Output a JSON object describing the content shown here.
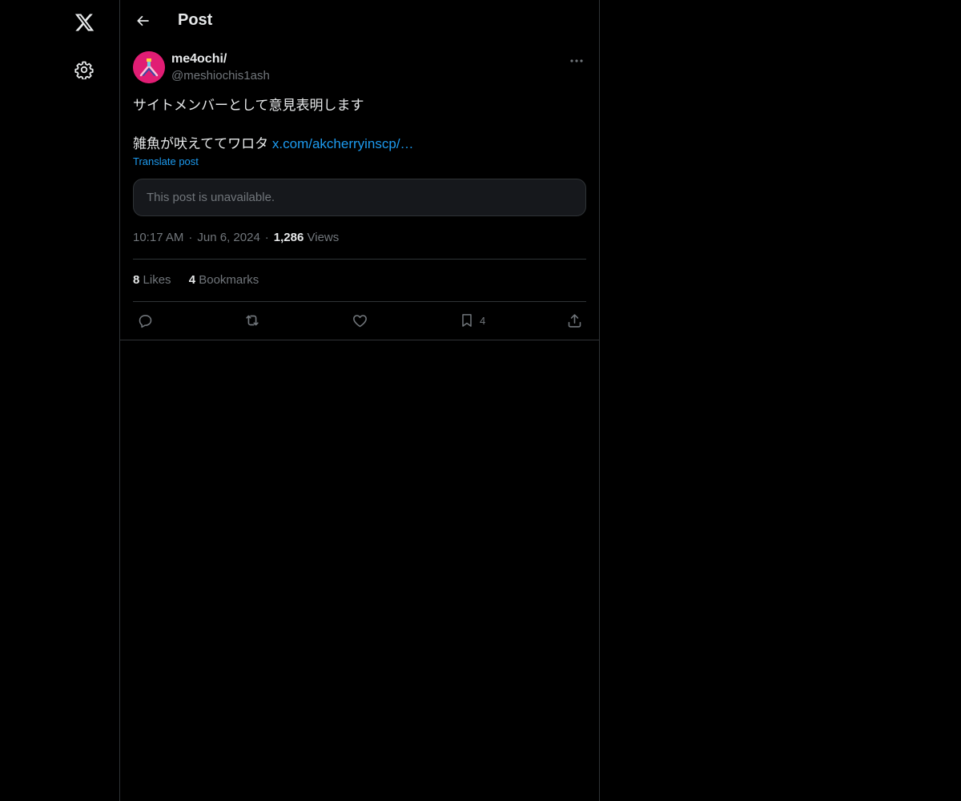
{
  "nav": {
    "logo_icon": "x-logo-icon",
    "settings_icon": "gear-icon"
  },
  "header": {
    "back_icon": "arrow-left-icon",
    "title": "Post"
  },
  "post": {
    "author_name": "me4ochi/",
    "author_handle": "@meshiochis1ash",
    "more_icon": "more-horizontal-icon",
    "text_line1": "サイトメンバーとして意見表明します",
    "text_line2": "雑魚が吠えててワロタ",
    "link_text": "x.com/akcherryinscp/…",
    "translate_label": "Translate post",
    "quote_unavailable": "This post is unavailable.",
    "time": "10:17 AM",
    "date": "Jun 6, 2024",
    "views_count": "1,286",
    "views_label": "Views",
    "likes_count": "8",
    "likes_label": "Likes",
    "bookmarks_count": "4",
    "bookmarks_label": "Bookmarks"
  },
  "actions": {
    "reply_icon": "reply-icon",
    "repost_icon": "repost-icon",
    "like_icon": "heart-icon",
    "bookmark_icon": "bookmark-icon",
    "bookmark_count": "4",
    "share_icon": "share-icon"
  },
  "colors": {
    "background": "#000000",
    "text": "#e7e9ea",
    "muted": "#71767b",
    "link": "#1d9bf0",
    "border": "#2f3336",
    "avatar": "#e11d74"
  }
}
